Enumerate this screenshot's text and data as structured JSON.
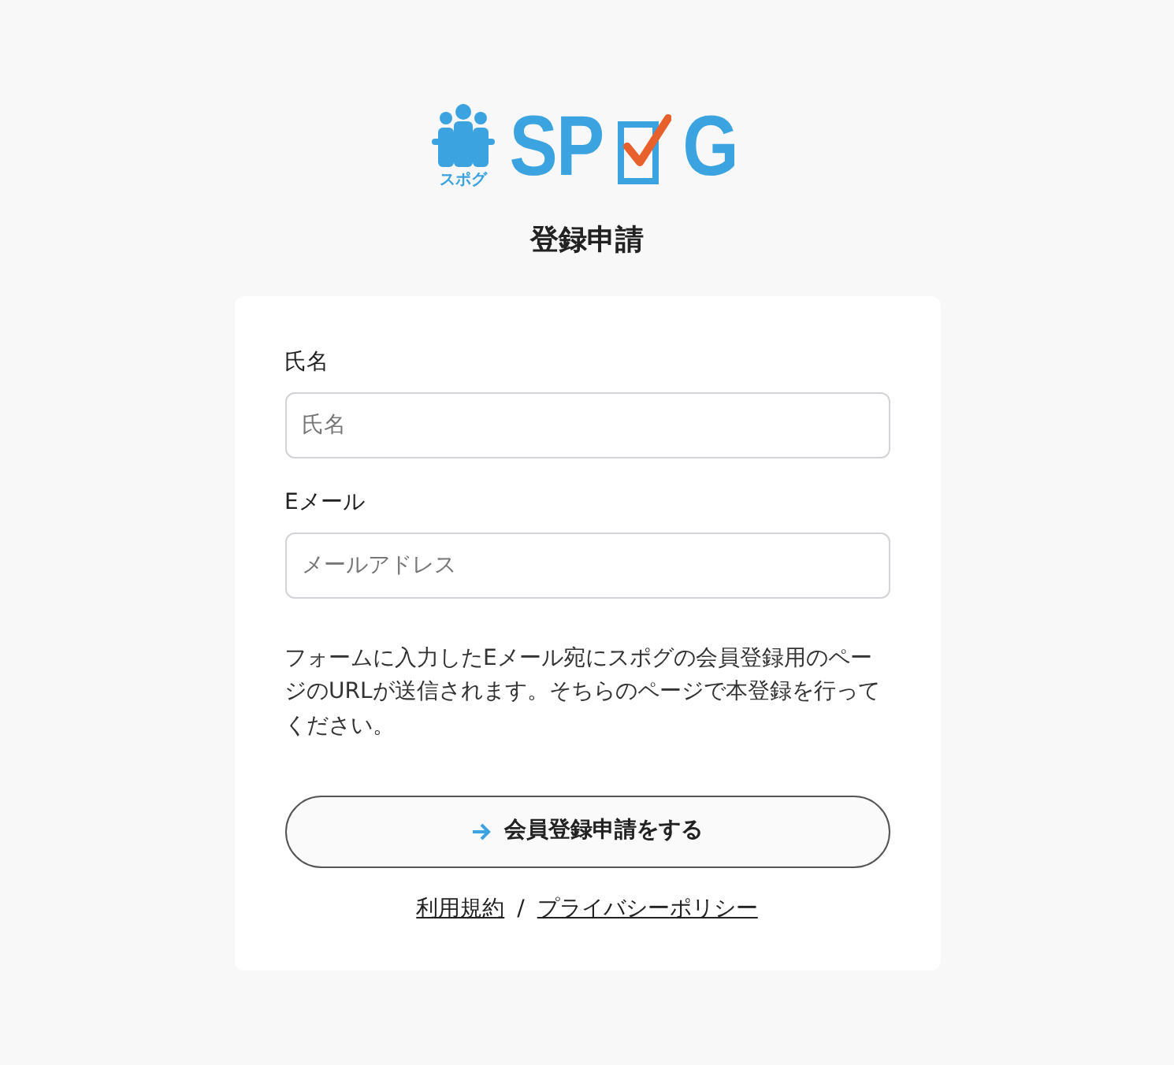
{
  "logo": {
    "wordmark_start": "SP",
    "wordmark_end": "G",
    "tagline": "スポグ"
  },
  "title": "登録申請",
  "form": {
    "fields": [
      {
        "label": "氏名",
        "placeholder": "氏名"
      },
      {
        "label": "Eメール",
        "placeholder": "メールアドレス"
      }
    ],
    "note": "フォームに入力したEメール宛にスポグの会員登録用のページのURLが送信されます。そちらのページで本登録を行ってください。",
    "submit": "会員登録申請をする"
  },
  "links": [
    "利用規約",
    "プライバシーポリシー"
  ],
  "link_separator": "/"
}
